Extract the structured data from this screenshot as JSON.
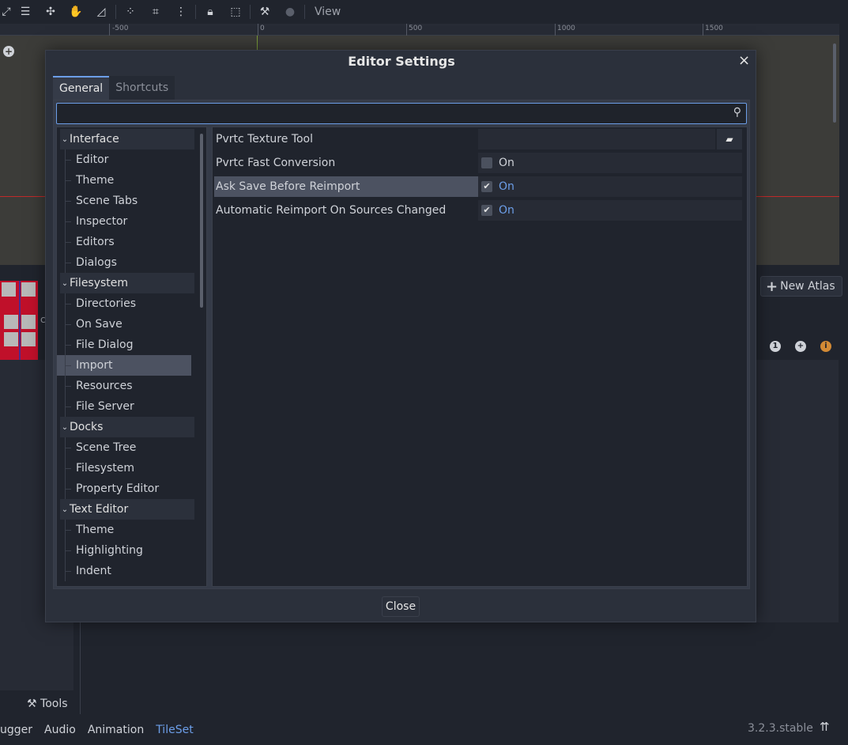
{
  "toolbar": {
    "view_menu": "View"
  },
  "ruler": {
    "labels": [
      "-500",
      "0",
      "500",
      "1000",
      "1500"
    ]
  },
  "tileset": {
    "new_atlas_label": "New Atlas",
    "tile_letter": "c"
  },
  "bottom": {
    "tools_label": "Tools",
    "tabs": [
      "ugger",
      "Audio",
      "Animation",
      "TileSet"
    ],
    "active_tab": "TileSet",
    "version": "3.2.3.stable"
  },
  "dialog": {
    "title": "Editor Settings",
    "close_icon": "×",
    "tabs": [
      "General",
      "Shortcuts"
    ],
    "search_placeholder": "",
    "close_button": "Close",
    "tree": [
      {
        "group": "Interface",
        "items": [
          "Editor",
          "Theme",
          "Scene Tabs",
          "Inspector",
          "Editors",
          "Dialogs"
        ]
      },
      {
        "group": "Filesystem",
        "items": [
          "Directories",
          "On Save",
          "File Dialog",
          "Import",
          "Resources",
          "File Server"
        ]
      },
      {
        "group": "Docks",
        "items": [
          "Scene Tree",
          "Filesystem",
          "Property Editor"
        ]
      },
      {
        "group": "Text Editor",
        "items": [
          "Theme",
          "Highlighting",
          "Indent"
        ]
      }
    ],
    "selected_item": "Import",
    "properties": [
      {
        "name": "Pvrtc Texture Tool",
        "type": "file",
        "value": ""
      },
      {
        "name": "Pvrtc Fast Conversion",
        "type": "check",
        "checked": false,
        "value": "On"
      },
      {
        "name": "Ask Save Before Reimport",
        "type": "check",
        "checked": true,
        "value": "On"
      },
      {
        "name": "Automatic Reimport On Sources Changed",
        "type": "check",
        "checked": true,
        "value": "On"
      }
    ]
  },
  "colors": {
    "accent": "#6c9ee8",
    "tile_red": "#c0102a"
  }
}
